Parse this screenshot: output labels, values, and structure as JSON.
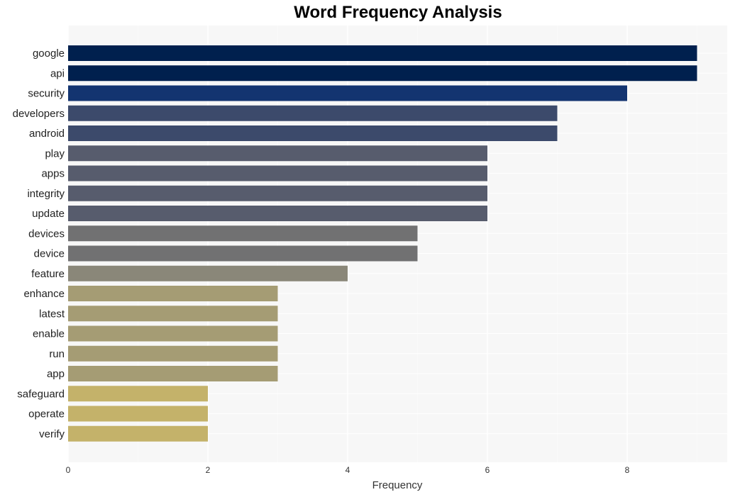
{
  "chart_data": {
    "type": "bar",
    "orientation": "horizontal",
    "title": "Word Frequency Analysis",
    "xlabel": "Frequency",
    "ylabel": "",
    "xlim": [
      0,
      9.45
    ],
    "xticks": [
      0,
      2,
      4,
      6,
      8
    ],
    "grid": true,
    "legend": "none",
    "categories": [
      "google",
      "api",
      "security",
      "developers",
      "android",
      "play",
      "apps",
      "integrity",
      "update",
      "devices",
      "device",
      "feature",
      "enhance",
      "latest",
      "enable",
      "run",
      "app",
      "safeguard",
      "operate",
      "verify"
    ],
    "values": [
      9,
      9,
      8,
      7,
      7,
      6,
      6,
      6,
      6,
      5,
      5,
      4,
      3,
      3,
      3,
      3,
      3,
      2,
      2,
      2
    ],
    "colors": [
      "#00204e",
      "#00204e",
      "#133470",
      "#3c4a6b",
      "#3c4a6b",
      "#575c6d",
      "#575c6d",
      "#575c6d",
      "#575c6d",
      "#717172",
      "#717172",
      "#8a8779",
      "#a59c74",
      "#a59c74",
      "#a59c74",
      "#a59c74",
      "#a59c74",
      "#c4b26a",
      "#c4b26a",
      "#c4b26a"
    ]
  }
}
